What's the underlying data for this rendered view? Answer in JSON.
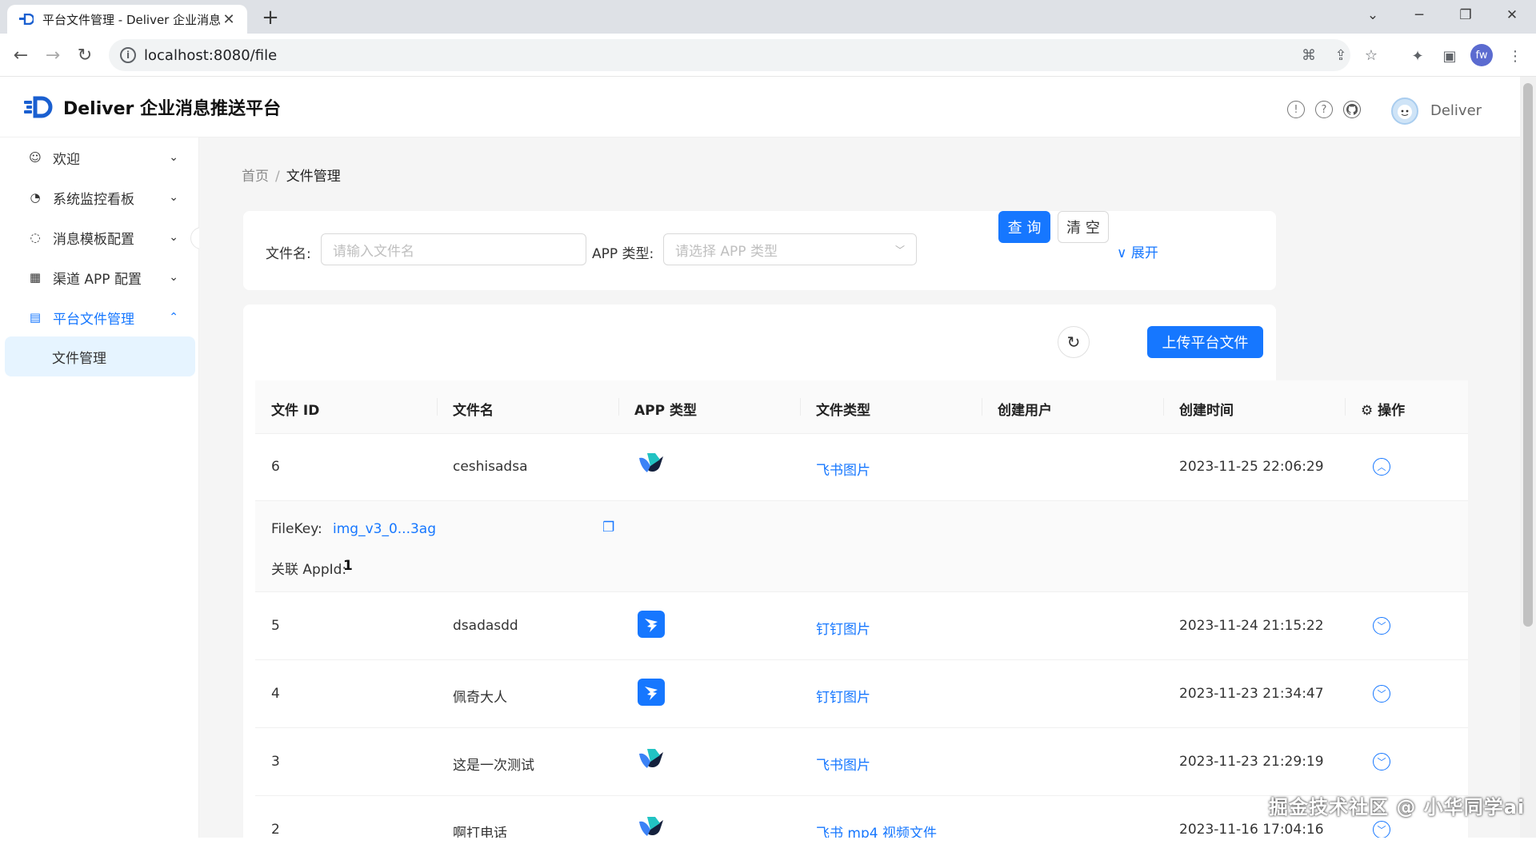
{
  "browser": {
    "tab_title": "平台文件管理 - Deliver 企业消息",
    "url": "localhost:8080/file",
    "profile_initials": "fw"
  },
  "header": {
    "brand": "Deliver 企业消息推送平台",
    "username": "Deliver"
  },
  "sidebar": {
    "items": [
      {
        "label": "欢迎",
        "icon": "smile-icon"
      },
      {
        "label": "系统监控看板",
        "icon": "dashboard-icon"
      },
      {
        "label": "消息模板配置",
        "icon": "message-icon"
      },
      {
        "label": "渠道 APP 配置",
        "icon": "appstore-icon"
      },
      {
        "label": "平台文件管理",
        "icon": "file-icon"
      }
    ],
    "sub_item": "文件管理"
  },
  "breadcrumb": {
    "home": "首页",
    "sep": "/",
    "current": "文件管理"
  },
  "filter": {
    "file_name_label": "文件名:",
    "file_name_placeholder": "请输入文件名",
    "app_type_label": "APP 类型:",
    "app_type_placeholder": "请选择 APP 类型",
    "query_button": "查 询",
    "clear_button": "清 空",
    "expand_link": "展开"
  },
  "table": {
    "upload_button": "上传平台文件",
    "columns": [
      "文件 ID",
      "文件名",
      "APP 类型",
      "文件类型",
      "创建用户",
      "创建时间",
      "操作"
    ],
    "rows": [
      {
        "id": "6",
        "name": "ceshisadsa",
        "app": "feishu",
        "type": "飞书图片",
        "user": "",
        "time": "2023-11-25 22:06:29",
        "expanded": true
      },
      {
        "id": "5",
        "name": "dsadasdd",
        "app": "dingtalk",
        "type": "钉钉图片",
        "user": "",
        "time": "2023-11-24 21:15:22"
      },
      {
        "id": "4",
        "name": "佩奇大人",
        "app": "dingtalk",
        "type": "钉钉图片",
        "user": "",
        "time": "2023-11-23 21:34:47"
      },
      {
        "id": "3",
        "name": "这是一次测试",
        "app": "feishu",
        "type": "飞书图片",
        "user": "",
        "time": "2023-11-23 21:29:19"
      },
      {
        "id": "2",
        "name": "啊打电话",
        "app": "feishu",
        "type": "飞书 mp4 视频文件",
        "user": "",
        "time": "2023-11-16 17:04:16"
      }
    ],
    "expanded_detail": {
      "filekey_label": "FileKey:",
      "filekey_value": "img_v3_0...3ag",
      "appid_label": "关联 AppId:",
      "appid_value": "1"
    }
  },
  "watermark": "掘金技术社区 @ 小华同学ai",
  "colors": {
    "primary": "#1677ff",
    "feishu": "#1a6fd6",
    "dingtalk": "#1677ff"
  }
}
